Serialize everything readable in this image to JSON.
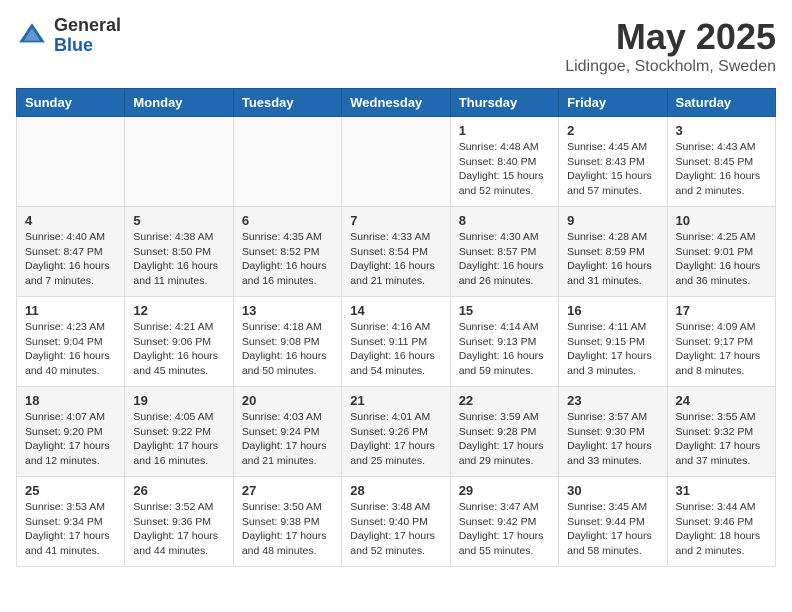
{
  "logo": {
    "general": "General",
    "blue": "Blue"
  },
  "title": "May 2025",
  "subtitle": "Lidingoe, Stockholm, Sweden",
  "days_header": [
    "Sunday",
    "Monday",
    "Tuesday",
    "Wednesday",
    "Thursday",
    "Friday",
    "Saturday"
  ],
  "weeks": [
    [
      {
        "day": "",
        "info": ""
      },
      {
        "day": "",
        "info": ""
      },
      {
        "day": "",
        "info": ""
      },
      {
        "day": "",
        "info": ""
      },
      {
        "day": "1",
        "info": "Sunrise: 4:48 AM\nSunset: 8:40 PM\nDaylight: 15 hours\nand 52 minutes."
      },
      {
        "day": "2",
        "info": "Sunrise: 4:45 AM\nSunset: 8:43 PM\nDaylight: 15 hours\nand 57 minutes."
      },
      {
        "day": "3",
        "info": "Sunrise: 4:43 AM\nSunset: 8:45 PM\nDaylight: 16 hours\nand 2 minutes."
      }
    ],
    [
      {
        "day": "4",
        "info": "Sunrise: 4:40 AM\nSunset: 8:47 PM\nDaylight: 16 hours\nand 7 minutes."
      },
      {
        "day": "5",
        "info": "Sunrise: 4:38 AM\nSunset: 8:50 PM\nDaylight: 16 hours\nand 11 minutes."
      },
      {
        "day": "6",
        "info": "Sunrise: 4:35 AM\nSunset: 8:52 PM\nDaylight: 16 hours\nand 16 minutes."
      },
      {
        "day": "7",
        "info": "Sunrise: 4:33 AM\nSunset: 8:54 PM\nDaylight: 16 hours\nand 21 minutes."
      },
      {
        "day": "8",
        "info": "Sunrise: 4:30 AM\nSunset: 8:57 PM\nDaylight: 16 hours\nand 26 minutes."
      },
      {
        "day": "9",
        "info": "Sunrise: 4:28 AM\nSunset: 8:59 PM\nDaylight: 16 hours\nand 31 minutes."
      },
      {
        "day": "10",
        "info": "Sunrise: 4:25 AM\nSunset: 9:01 PM\nDaylight: 16 hours\nand 36 minutes."
      }
    ],
    [
      {
        "day": "11",
        "info": "Sunrise: 4:23 AM\nSunset: 9:04 PM\nDaylight: 16 hours\nand 40 minutes."
      },
      {
        "day": "12",
        "info": "Sunrise: 4:21 AM\nSunset: 9:06 PM\nDaylight: 16 hours\nand 45 minutes."
      },
      {
        "day": "13",
        "info": "Sunrise: 4:18 AM\nSunset: 9:08 PM\nDaylight: 16 hours\nand 50 minutes."
      },
      {
        "day": "14",
        "info": "Sunrise: 4:16 AM\nSunset: 9:11 PM\nDaylight: 16 hours\nand 54 minutes."
      },
      {
        "day": "15",
        "info": "Sunrise: 4:14 AM\nSunset: 9:13 PM\nDaylight: 16 hours\nand 59 minutes."
      },
      {
        "day": "16",
        "info": "Sunrise: 4:11 AM\nSunset: 9:15 PM\nDaylight: 17 hours\nand 3 minutes."
      },
      {
        "day": "17",
        "info": "Sunrise: 4:09 AM\nSunset: 9:17 PM\nDaylight: 17 hours\nand 8 minutes."
      }
    ],
    [
      {
        "day": "18",
        "info": "Sunrise: 4:07 AM\nSunset: 9:20 PM\nDaylight: 17 hours\nand 12 minutes."
      },
      {
        "day": "19",
        "info": "Sunrise: 4:05 AM\nSunset: 9:22 PM\nDaylight: 17 hours\nand 16 minutes."
      },
      {
        "day": "20",
        "info": "Sunrise: 4:03 AM\nSunset: 9:24 PM\nDaylight: 17 hours\nand 21 minutes."
      },
      {
        "day": "21",
        "info": "Sunrise: 4:01 AM\nSunset: 9:26 PM\nDaylight: 17 hours\nand 25 minutes."
      },
      {
        "day": "22",
        "info": "Sunrise: 3:59 AM\nSunset: 9:28 PM\nDaylight: 17 hours\nand 29 minutes."
      },
      {
        "day": "23",
        "info": "Sunrise: 3:57 AM\nSunset: 9:30 PM\nDaylight: 17 hours\nand 33 minutes."
      },
      {
        "day": "24",
        "info": "Sunrise: 3:55 AM\nSunset: 9:32 PM\nDaylight: 17 hours\nand 37 minutes."
      }
    ],
    [
      {
        "day": "25",
        "info": "Sunrise: 3:53 AM\nSunset: 9:34 PM\nDaylight: 17 hours\nand 41 minutes."
      },
      {
        "day": "26",
        "info": "Sunrise: 3:52 AM\nSunset: 9:36 PM\nDaylight: 17 hours\nand 44 minutes."
      },
      {
        "day": "27",
        "info": "Sunrise: 3:50 AM\nSunset: 9:38 PM\nDaylight: 17 hours\nand 48 minutes."
      },
      {
        "day": "28",
        "info": "Sunrise: 3:48 AM\nSunset: 9:40 PM\nDaylight: 17 hours\nand 52 minutes."
      },
      {
        "day": "29",
        "info": "Sunrise: 3:47 AM\nSunset: 9:42 PM\nDaylight: 17 hours\nand 55 minutes."
      },
      {
        "day": "30",
        "info": "Sunrise: 3:45 AM\nSunset: 9:44 PM\nDaylight: 17 hours\nand 58 minutes."
      },
      {
        "day": "31",
        "info": "Sunrise: 3:44 AM\nSunset: 9:46 PM\nDaylight: 18 hours\nand 2 minutes."
      }
    ]
  ]
}
